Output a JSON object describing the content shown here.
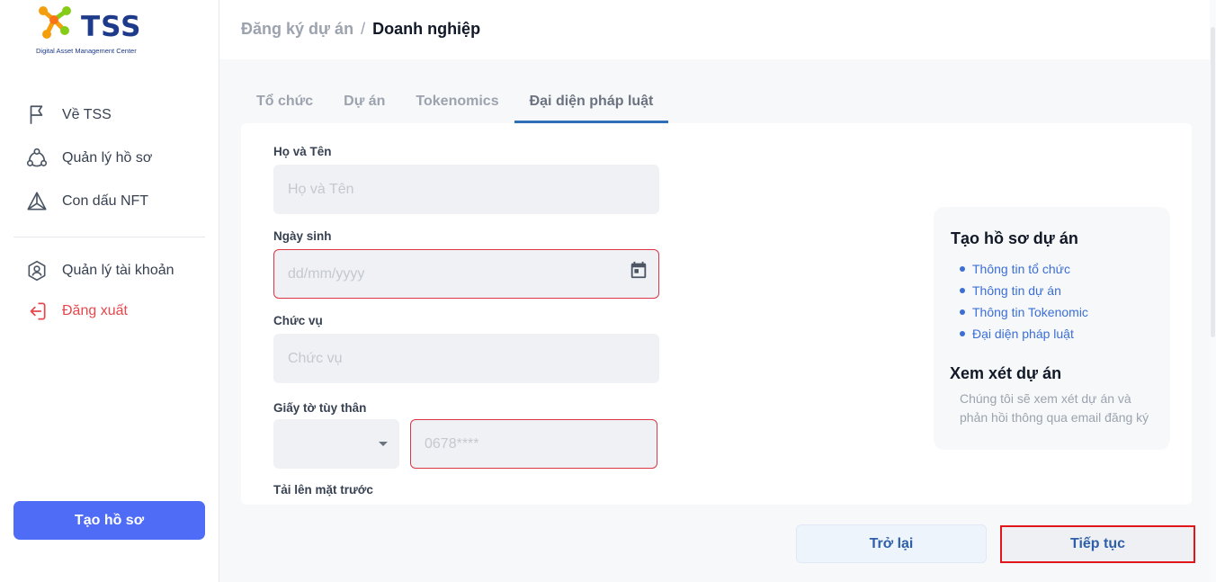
{
  "brand": {
    "name": "TSS",
    "tagline": "Digital Asset Management Center",
    "colors": {
      "orange": "#f59e0b",
      "green": "#84cc16",
      "navy": "#1e3a8a"
    }
  },
  "sidebar": {
    "items": [
      {
        "label": "Về TSS",
        "icon": "flag-icon"
      },
      {
        "label": "Quản lý hồ sơ",
        "icon": "network-icon"
      },
      {
        "label": "Con dấu NFT",
        "icon": "triangle-nodes-icon"
      },
      {
        "label": "Quản lý tài khoản",
        "icon": "user-shield-icon"
      },
      {
        "label": "Đăng xuất",
        "icon": "logout-icon"
      }
    ],
    "create_button": "Tạo hồ sơ"
  },
  "header": {
    "breadcrumb_parent": "Đăng ký dự án",
    "breadcrumb_separator": "/",
    "breadcrumb_current": "Doanh nghiệp"
  },
  "tabs": [
    {
      "label": "Tổ chức"
    },
    {
      "label": "Dự án"
    },
    {
      "label": "Tokenomics"
    },
    {
      "label": "Đại diện pháp luật",
      "active": true
    }
  ],
  "form": {
    "full_name": {
      "label": "Họ và Tên",
      "placeholder": "Họ và Tên",
      "value": ""
    },
    "birth_date": {
      "label": "Ngày sinh",
      "placeholder": "dd/mm/yyyy",
      "value": ""
    },
    "position": {
      "label": "Chức vụ",
      "placeholder": "Chức vụ",
      "value": ""
    },
    "id_document": {
      "label": "Giấy tờ tùy thân",
      "type_value": "",
      "number_placeholder": "0678****"
    },
    "upload_front": {
      "label": "Tải lên mặt trước"
    }
  },
  "info_panel": {
    "title": "Tạo hồ sơ dự án",
    "steps": [
      "Thông tin tổ chức",
      "Thông tin dự án",
      "Thông tin Tokenomic",
      "Đại diện pháp luật"
    ],
    "review_title": "Xem xét dự án",
    "review_text": "Chúng tôi sẽ xem xét dự án và phản hồi thông qua email đăng ký"
  },
  "actions": {
    "back": "Trở lại",
    "next": "Tiếp tục"
  }
}
